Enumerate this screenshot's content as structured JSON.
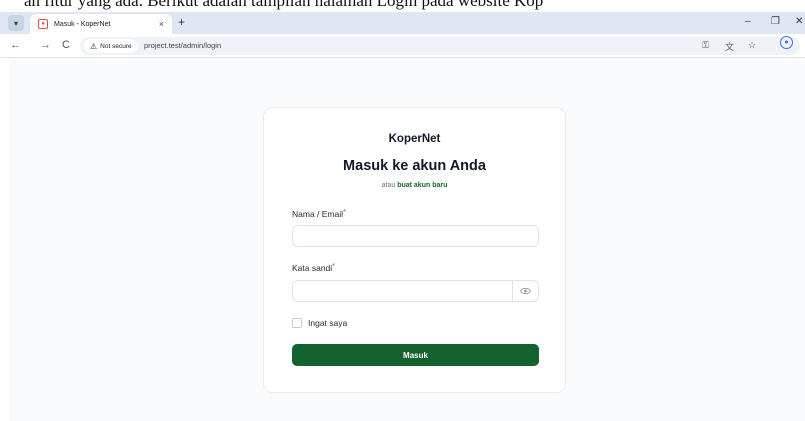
{
  "caption": {
    "text": "an fitur yang ada. Berikut adalah tampilan halaman Login pada website Kop"
  },
  "browser": {
    "tab_title": "Masuk - KoperNet",
    "tab_close": "×",
    "new_tab": "+",
    "minimize": "–",
    "restore": "❐",
    "close": "✕",
    "back": "←",
    "forward": "→",
    "reload": "C",
    "security_label": "Not secure",
    "url": "project.test/admin/login"
  },
  "login": {
    "brand": "KoperNet",
    "heading": "Masuk ke akun Anda",
    "or_text": "atau",
    "register_link": "buat akun baru",
    "email_label": "Nama / Email",
    "email_value": "",
    "password_label": "Kata sandi",
    "password_value": "",
    "required_mark": "*",
    "remember_label": "Ingat saya",
    "submit_label": "Masuk"
  },
  "colors": {
    "accent": "#14632f",
    "link": "#166534",
    "required": "#dc2626"
  },
  "icons": {
    "password_toggle": "eye-icon",
    "security": "warning-icon",
    "password_manager": "key-icon",
    "translate": "translate-icon",
    "bookmark": "star-icon",
    "profile": "profile-icon"
  }
}
